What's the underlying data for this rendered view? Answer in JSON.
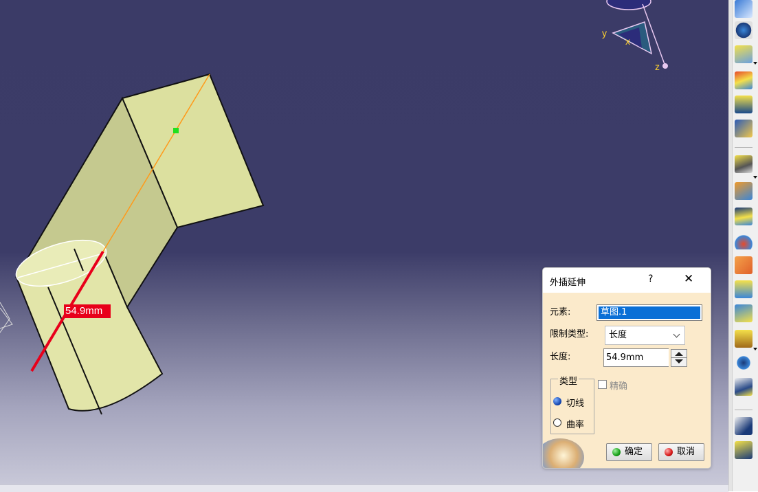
{
  "viewport": {
    "dimension_label": "54.9mm",
    "compass": {
      "x_label": "x",
      "y_label": "y",
      "z_label": "z"
    }
  },
  "dialog": {
    "title": "外插延伸",
    "help": "?",
    "close": "✕",
    "element_label": "元素:",
    "element_value": "草图.1",
    "limit_type_label": "限制类型:",
    "limit_type_value": "长度",
    "length_label": "长度:",
    "length_value": "54.9mm",
    "type_group_label": "类型",
    "type_options": [
      {
        "label": "切线",
        "selected": true
      },
      {
        "label": "曲率",
        "selected": false
      }
    ],
    "precise_label": "精确",
    "precise_checked": false,
    "ok_label": "确定",
    "cancel_label": "取消"
  },
  "toolbar": {
    "icons": [
      "join-surface-icon",
      "healing-icon",
      "extract-icon",
      "fill-icon",
      "blend-icon",
      "sweep-icon",
      "split-icon",
      "trim-icon",
      "offset-surface-icon",
      "boundary-icon",
      "extrapolate-icon",
      "translate-icon",
      "rotate-icon",
      "shape-fillet-icon",
      "scaling-icon",
      "sketch-icon",
      "spline-icon",
      "surface-icon"
    ]
  },
  "colors": {
    "viewport_top": "#3b3b67",
    "viewport_bottom": "#c8c8d8",
    "solid_face_light": "#dfe3a6",
    "solid_face_shade": "#c3c78e",
    "dimension_red": "#e8001a",
    "dialog_bg": "#fbeacb",
    "selection_blue": "#0a6fd6"
  }
}
